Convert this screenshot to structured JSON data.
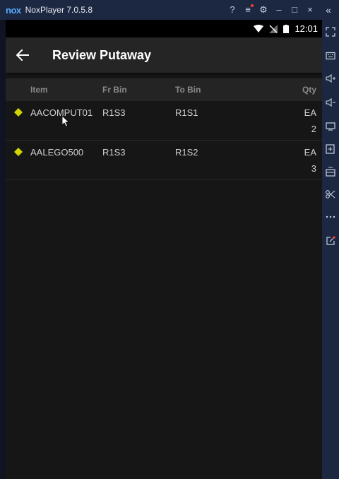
{
  "window": {
    "brand": "nox",
    "title": "NoxPlayer 7.0.5.8",
    "controls": {
      "help": "?",
      "menu": "≡",
      "settings": "⚙",
      "minimize": "–",
      "maximize": "□",
      "close": "×",
      "collapse": "«"
    }
  },
  "status_bar": {
    "time": "12:01"
  },
  "app_bar": {
    "title": "Review Putaway"
  },
  "table": {
    "columns": {
      "item": "Item",
      "from_bin": "Fr Bin",
      "to_bin": "To Bin",
      "qty": "Qty"
    },
    "rows": [
      {
        "item": "AACOMPUT01",
        "from_bin": "R1S3",
        "to_bin": "R1S1",
        "uom": "EA",
        "qty": "2"
      },
      {
        "item": "AALEGO500",
        "from_bin": "R1S3",
        "to_bin": "R1S2",
        "uom": "EA",
        "qty": "3"
      }
    ]
  },
  "sidebar_tools": [
    "fullscreen-icon",
    "keyboard-icon",
    "volume-up-icon",
    "volume-down-icon",
    "screen-icon",
    "add-apk-icon",
    "toolbox-icon",
    "scissors-icon",
    "more-icon",
    "edit-icon"
  ],
  "colors": {
    "accent_diamond": "#d4d400",
    "nox_frame": "#1c2741",
    "nox_brand": "#58a8ff",
    "app_bar": "#252525",
    "screen_bg": "#161616"
  }
}
